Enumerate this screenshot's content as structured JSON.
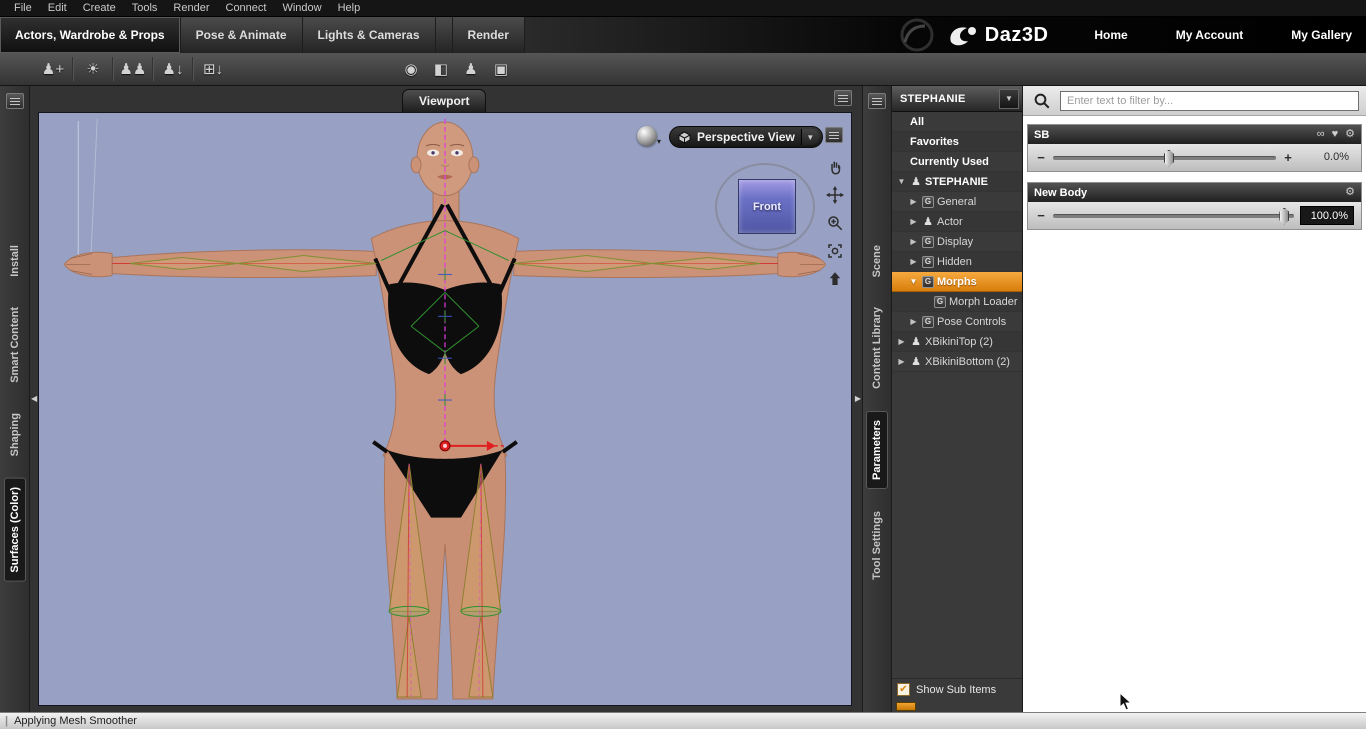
{
  "menubar": {
    "items": [
      "File",
      "Edit",
      "Create",
      "Tools",
      "Render",
      "Connect",
      "Window",
      "Help"
    ]
  },
  "tabbar": {
    "tabs": [
      {
        "label": "Actors, Wardrobe & Props",
        "active": true
      },
      {
        "label": "Pose & Animate",
        "active": false
      },
      {
        "label": "Lights & Cameras",
        "active": false
      },
      {
        "label": "Render",
        "active": false
      }
    ],
    "brand": "Daz3D",
    "nav": [
      "Home",
      "My Account",
      "My Gallery"
    ]
  },
  "toolbar": {
    "left_icons": [
      {
        "name": "create-figure-icon",
        "glyph": "♟+"
      },
      {
        "name": "create-light-icon",
        "glyph": "☀"
      },
      {
        "name": "duplicate-figures-icon",
        "glyph": "♟♟"
      },
      {
        "name": "import-figure-icon",
        "glyph": "♟↓"
      },
      {
        "name": "export-grid-icon",
        "glyph": "⊞↓"
      }
    ],
    "center_icons": [
      {
        "name": "orbit-camera-tool-icon",
        "glyph": "◉"
      },
      {
        "name": "rotate-cube-tool-icon",
        "glyph": "◧"
      },
      {
        "name": "node-select-tool-icon",
        "glyph": "♟"
      },
      {
        "name": "camera-frame-tool-icon",
        "glyph": "▣"
      }
    ]
  },
  "left_dock": {
    "tabs": [
      {
        "label": "Install",
        "active": false
      },
      {
        "label": "Smart Content",
        "active": false
      },
      {
        "label": "Shaping",
        "active": false
      },
      {
        "label": "Surfaces (Color)",
        "active": true
      }
    ]
  },
  "right_dock": {
    "tabs": [
      {
        "label": "Scene",
        "active": false
      },
      {
        "label": "Content Library",
        "active": false
      },
      {
        "label": "Parameters",
        "active": true
      },
      {
        "label": "Tool Settings",
        "active": false
      }
    ]
  },
  "viewport": {
    "pane_tab": "Viewport",
    "view_selector": "Perspective View",
    "view_cube": "Front",
    "dropdown_glyph": "▼",
    "collapse_left_glyph": "◀",
    "collapse_right_glyph": "▶"
  },
  "parameters": {
    "header": "STEPHANIE",
    "header_dropdown_glyph": "▼",
    "expand_down_glyph": "▼",
    "expand_right_glyph": "▶",
    "figure_icon_glyph": "♟",
    "group_icon_glyph": "G",
    "rows": [
      {
        "label": "All",
        "level": 0,
        "bold": true
      },
      {
        "label": "Favorites",
        "level": 0,
        "bold": true
      },
      {
        "label": "Currently Used",
        "level": 0,
        "bold": true
      },
      {
        "label": "STEPHANIE",
        "level": 0,
        "expand": "down",
        "icon": "figure",
        "bold": true
      },
      {
        "label": "General",
        "level": 1,
        "expand": "right",
        "icon": "G"
      },
      {
        "label": "Actor",
        "level": 1,
        "expand": "right",
        "icon": "figure"
      },
      {
        "label": "Display",
        "level": 1,
        "expand": "right",
        "icon": "G"
      },
      {
        "label": "Hidden",
        "level": 1,
        "expand": "right",
        "icon": "G"
      },
      {
        "label": "Morphs",
        "level": 1,
        "expand": "down",
        "icon": "G",
        "selected": true
      },
      {
        "label": "Morph Loader",
        "level": 2,
        "icon": "G"
      },
      {
        "label": "Pose Controls",
        "level": 1,
        "expand": "right",
        "icon": "G"
      },
      {
        "label": "XBikiniTop (2)",
        "level": 0,
        "expand": "right",
        "icon": "figure"
      },
      {
        "label": "XBikiniBottom (2)",
        "level": 0,
        "expand": "right",
        "icon": "figure"
      }
    ],
    "show_sub_items": "Show Sub Items",
    "check_glyph": "✔"
  },
  "editor": {
    "filter_placeholder": "Enter text to filter by...",
    "minus_glyph": "−",
    "plus_glyph": "+",
    "icon_glyphs": {
      "link": "∞",
      "heart": "♥",
      "gear": "⚙"
    },
    "groups": [
      {
        "name": "SB",
        "value": "0.0%",
        "handle_percent": 52,
        "value_dark": false
      },
      {
        "name": "New Body",
        "value": "100.0%",
        "handle_percent": 96,
        "value_dark": true
      }
    ]
  },
  "statusbar": {
    "text": "Applying Mesh Smoother",
    "grip": "|"
  },
  "colors": {
    "accent_orange": "#e8941f",
    "viewport_bg": "#98a1c3",
    "cube_purple": "#6b71c6"
  }
}
